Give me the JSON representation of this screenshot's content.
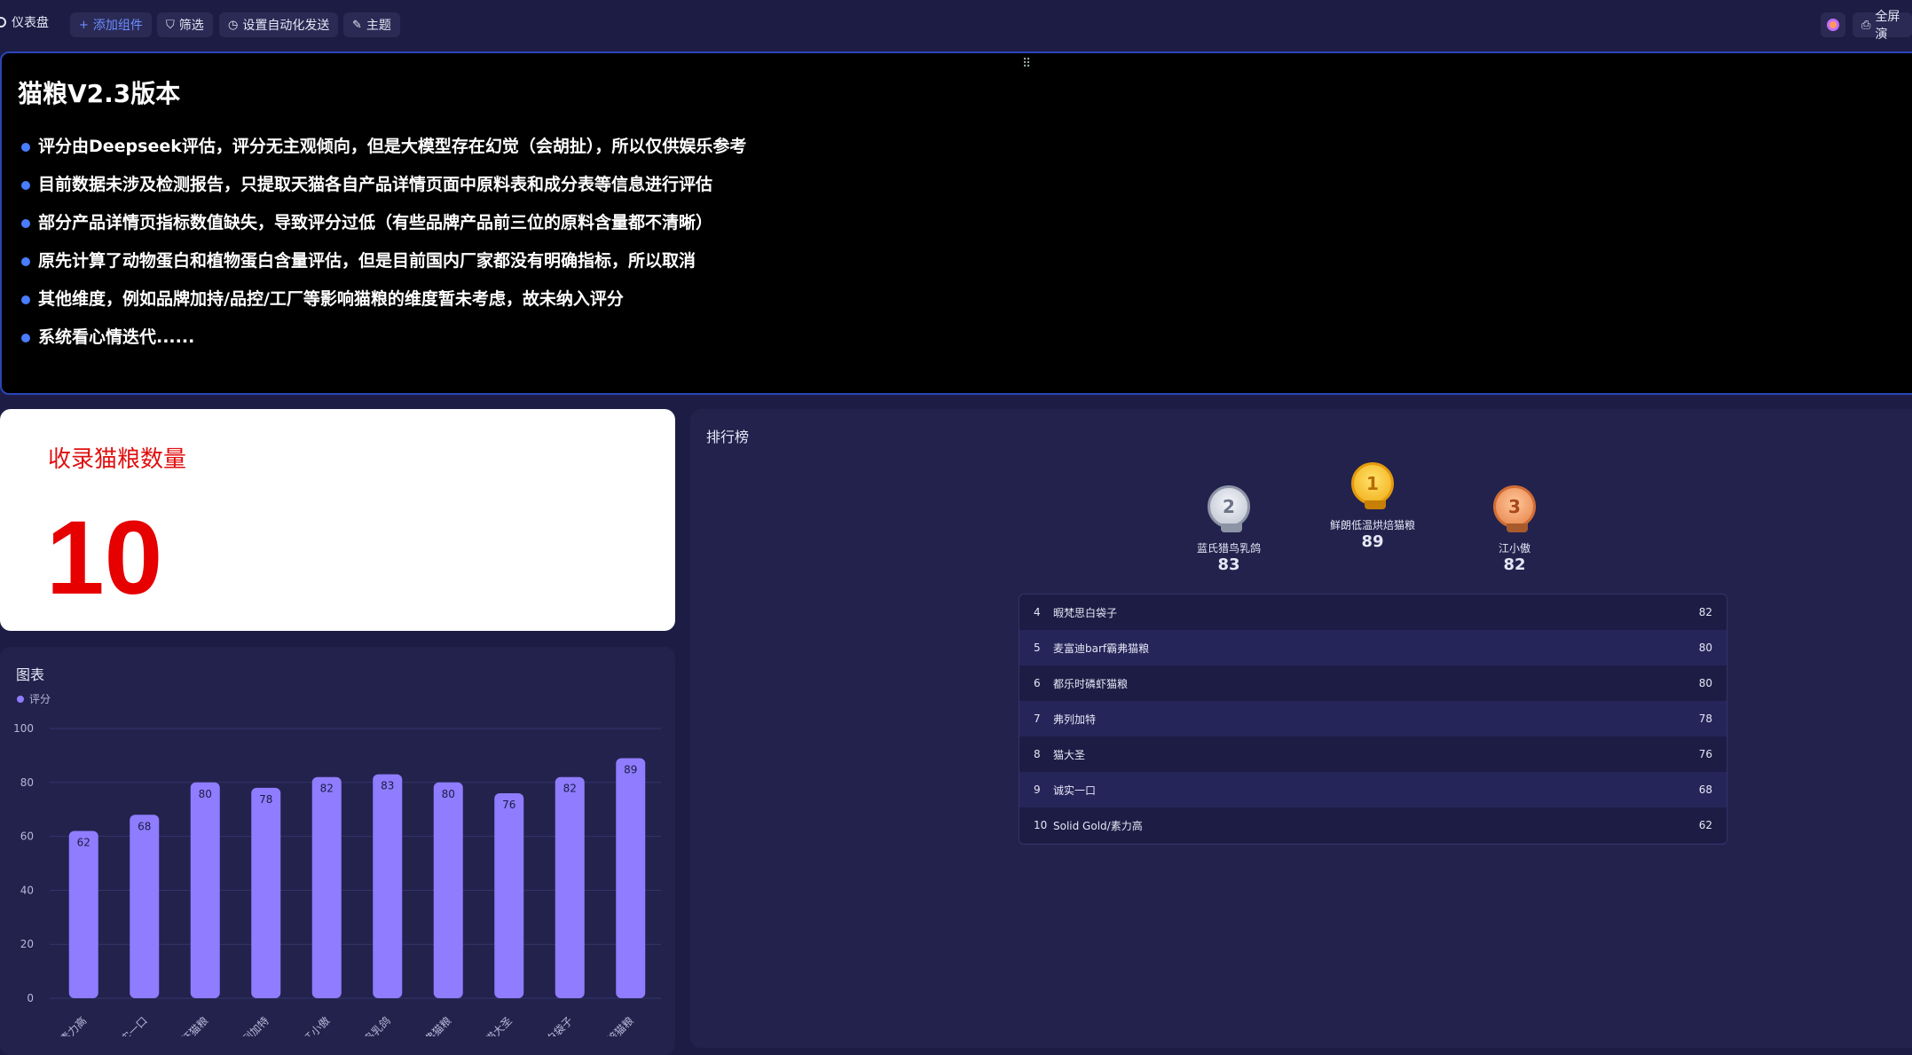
{
  "topbar": {
    "title": "仪表盘",
    "add_widget": "添加组件",
    "filter": "筛选",
    "auto_send": "设置自动化发送",
    "theme": "主题",
    "fullscreen": "全屏演"
  },
  "notice": {
    "title": "猫粮V2.3版本",
    "items": [
      "评分由Deepseek评估，评分无主观倾向，但是大模型存在幻觉（会胡扯），所以仅供娱乐参考",
      "目前数据未涉及检测报告，只提取天猫各自产品详情页面中原料表和成分表等信息进行评估",
      "部分产品详情页指标数值缺失，导致评分过低（有些品牌产品前三位的原料含量都不清晰）",
      "原先计算了动物蛋白和植物蛋白含量评估，但是目前国内厂家都没有明确指标，所以取消",
      "其他维度，例如品牌加持/品控/工厂等影响猫粮的维度暂未考虑，故未纳入评分",
      "系统看心情迭代......"
    ]
  },
  "count_card": {
    "label": "收录猫粮数量",
    "value": "10"
  },
  "chart_card": {
    "title": "图表",
    "legend": "评分"
  },
  "chart_data": {
    "type": "bar",
    "categories": [
      "素力高",
      "诚实一口",
      "都乐时磷虾猫粮",
      "弗列加特",
      "江小傲",
      "蓝氏猎鸟乳鸽",
      "麦富迪barf霸弗猫粮",
      "猫大圣",
      "暇梵思白袋子",
      "鲜朗低温烘焙猫粮"
    ],
    "tick_labels": [
      "素力高",
      "实一口",
      "虾猫粮",
      "列加特",
      "江小傲",
      "鸟乳鸽",
      "弗猫粮",
      "猫大圣",
      "白袋子",
      "焙猫粮"
    ],
    "series": [
      {
        "name": "评分",
        "values": [
          62,
          68,
          80,
          78,
          82,
          83,
          80,
          76,
          82,
          89
        ]
      }
    ],
    "ylim": [
      0,
      100
    ],
    "yticks": [
      0,
      20,
      40,
      60,
      80,
      100
    ],
    "grid": true,
    "legend": "top-left",
    "bar_color": "#8f7cff"
  },
  "ranking": {
    "title": "排行榜",
    "podium": [
      {
        "rank": "2",
        "name": "蓝氏猎鸟乳鸽",
        "score": "83"
      },
      {
        "rank": "1",
        "name": "鲜朗低温烘焙猫粮",
        "score": "89"
      },
      {
        "rank": "3",
        "name": "江小傲",
        "score": "82"
      }
    ],
    "rows": [
      {
        "rank": "4",
        "name": "暇梵思白袋子",
        "score": "82"
      },
      {
        "rank": "5",
        "name": "麦富迪barf霸弗猫粮",
        "score": "80"
      },
      {
        "rank": "6",
        "name": "都乐时磷虾猫粮",
        "score": "80"
      },
      {
        "rank": "7",
        "name": "弗列加特",
        "score": "78"
      },
      {
        "rank": "8",
        "name": "猫大圣",
        "score": "76"
      },
      {
        "rank": "9",
        "name": "诚实一口",
        "score": "68"
      },
      {
        "rank": "10",
        "name": "Solid Gold/素力高",
        "score": "62"
      }
    ]
  }
}
